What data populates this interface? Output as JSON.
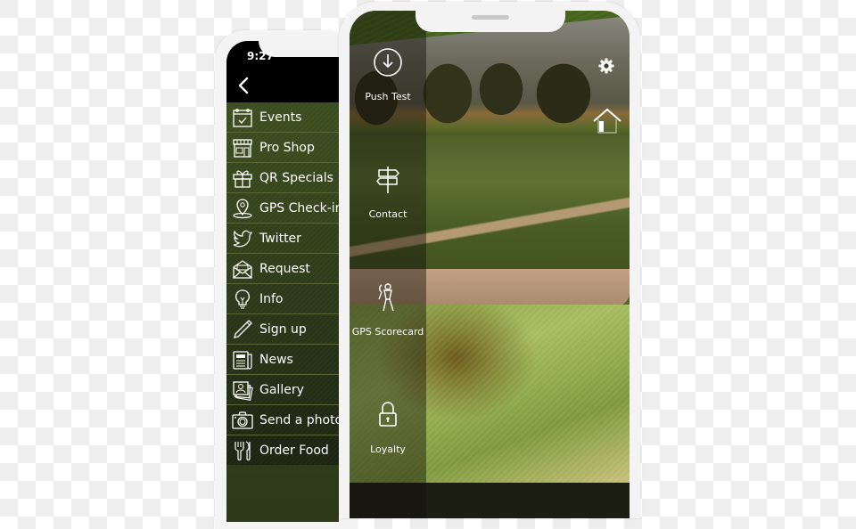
{
  "left_phone": {
    "status_time": "9:27",
    "back_icon": "chevron-left-icon",
    "menu": [
      {
        "label": "Events",
        "icon": "calendar-check-icon"
      },
      {
        "label": "Pro Shop",
        "icon": "storefront-icon"
      },
      {
        "label": "QR Specials",
        "icon": "gift-icon"
      },
      {
        "label": "GPS Check-in",
        "icon": "map-pin-icon"
      },
      {
        "label": "Twitter",
        "icon": "twitter-bird-icon"
      },
      {
        "label": "Request",
        "icon": "envelope-open-icon"
      },
      {
        "label": "Info",
        "icon": "lightbulb-icon"
      },
      {
        "label": "Sign up",
        "icon": "pencil-icon"
      },
      {
        "label": "News",
        "icon": "newspaper-icon"
      },
      {
        "label": "Gallery",
        "icon": "photo-gallery-icon"
      },
      {
        "label": "Send a photo",
        "icon": "camera-icon"
      },
      {
        "label": "Order Food",
        "icon": "fork-knife-icon"
      }
    ]
  },
  "right_phone": {
    "side_menu": [
      {
        "label": "Push Test",
        "icon": "download-circle-icon"
      },
      {
        "label": "Contact",
        "icon": "signpost-icon"
      },
      {
        "label": "GPS Scorecard",
        "icon": "golfer-icon"
      },
      {
        "label": "Loyalty",
        "icon": "padlock-icon"
      }
    ],
    "settings_icon": "gear-icon",
    "home_icon": "home-icon"
  },
  "colors": {
    "menu_green": "#3c4e1f",
    "status_bar": "#000000",
    "accent_green": "#6f9a2a",
    "text": "#ffffff"
  }
}
